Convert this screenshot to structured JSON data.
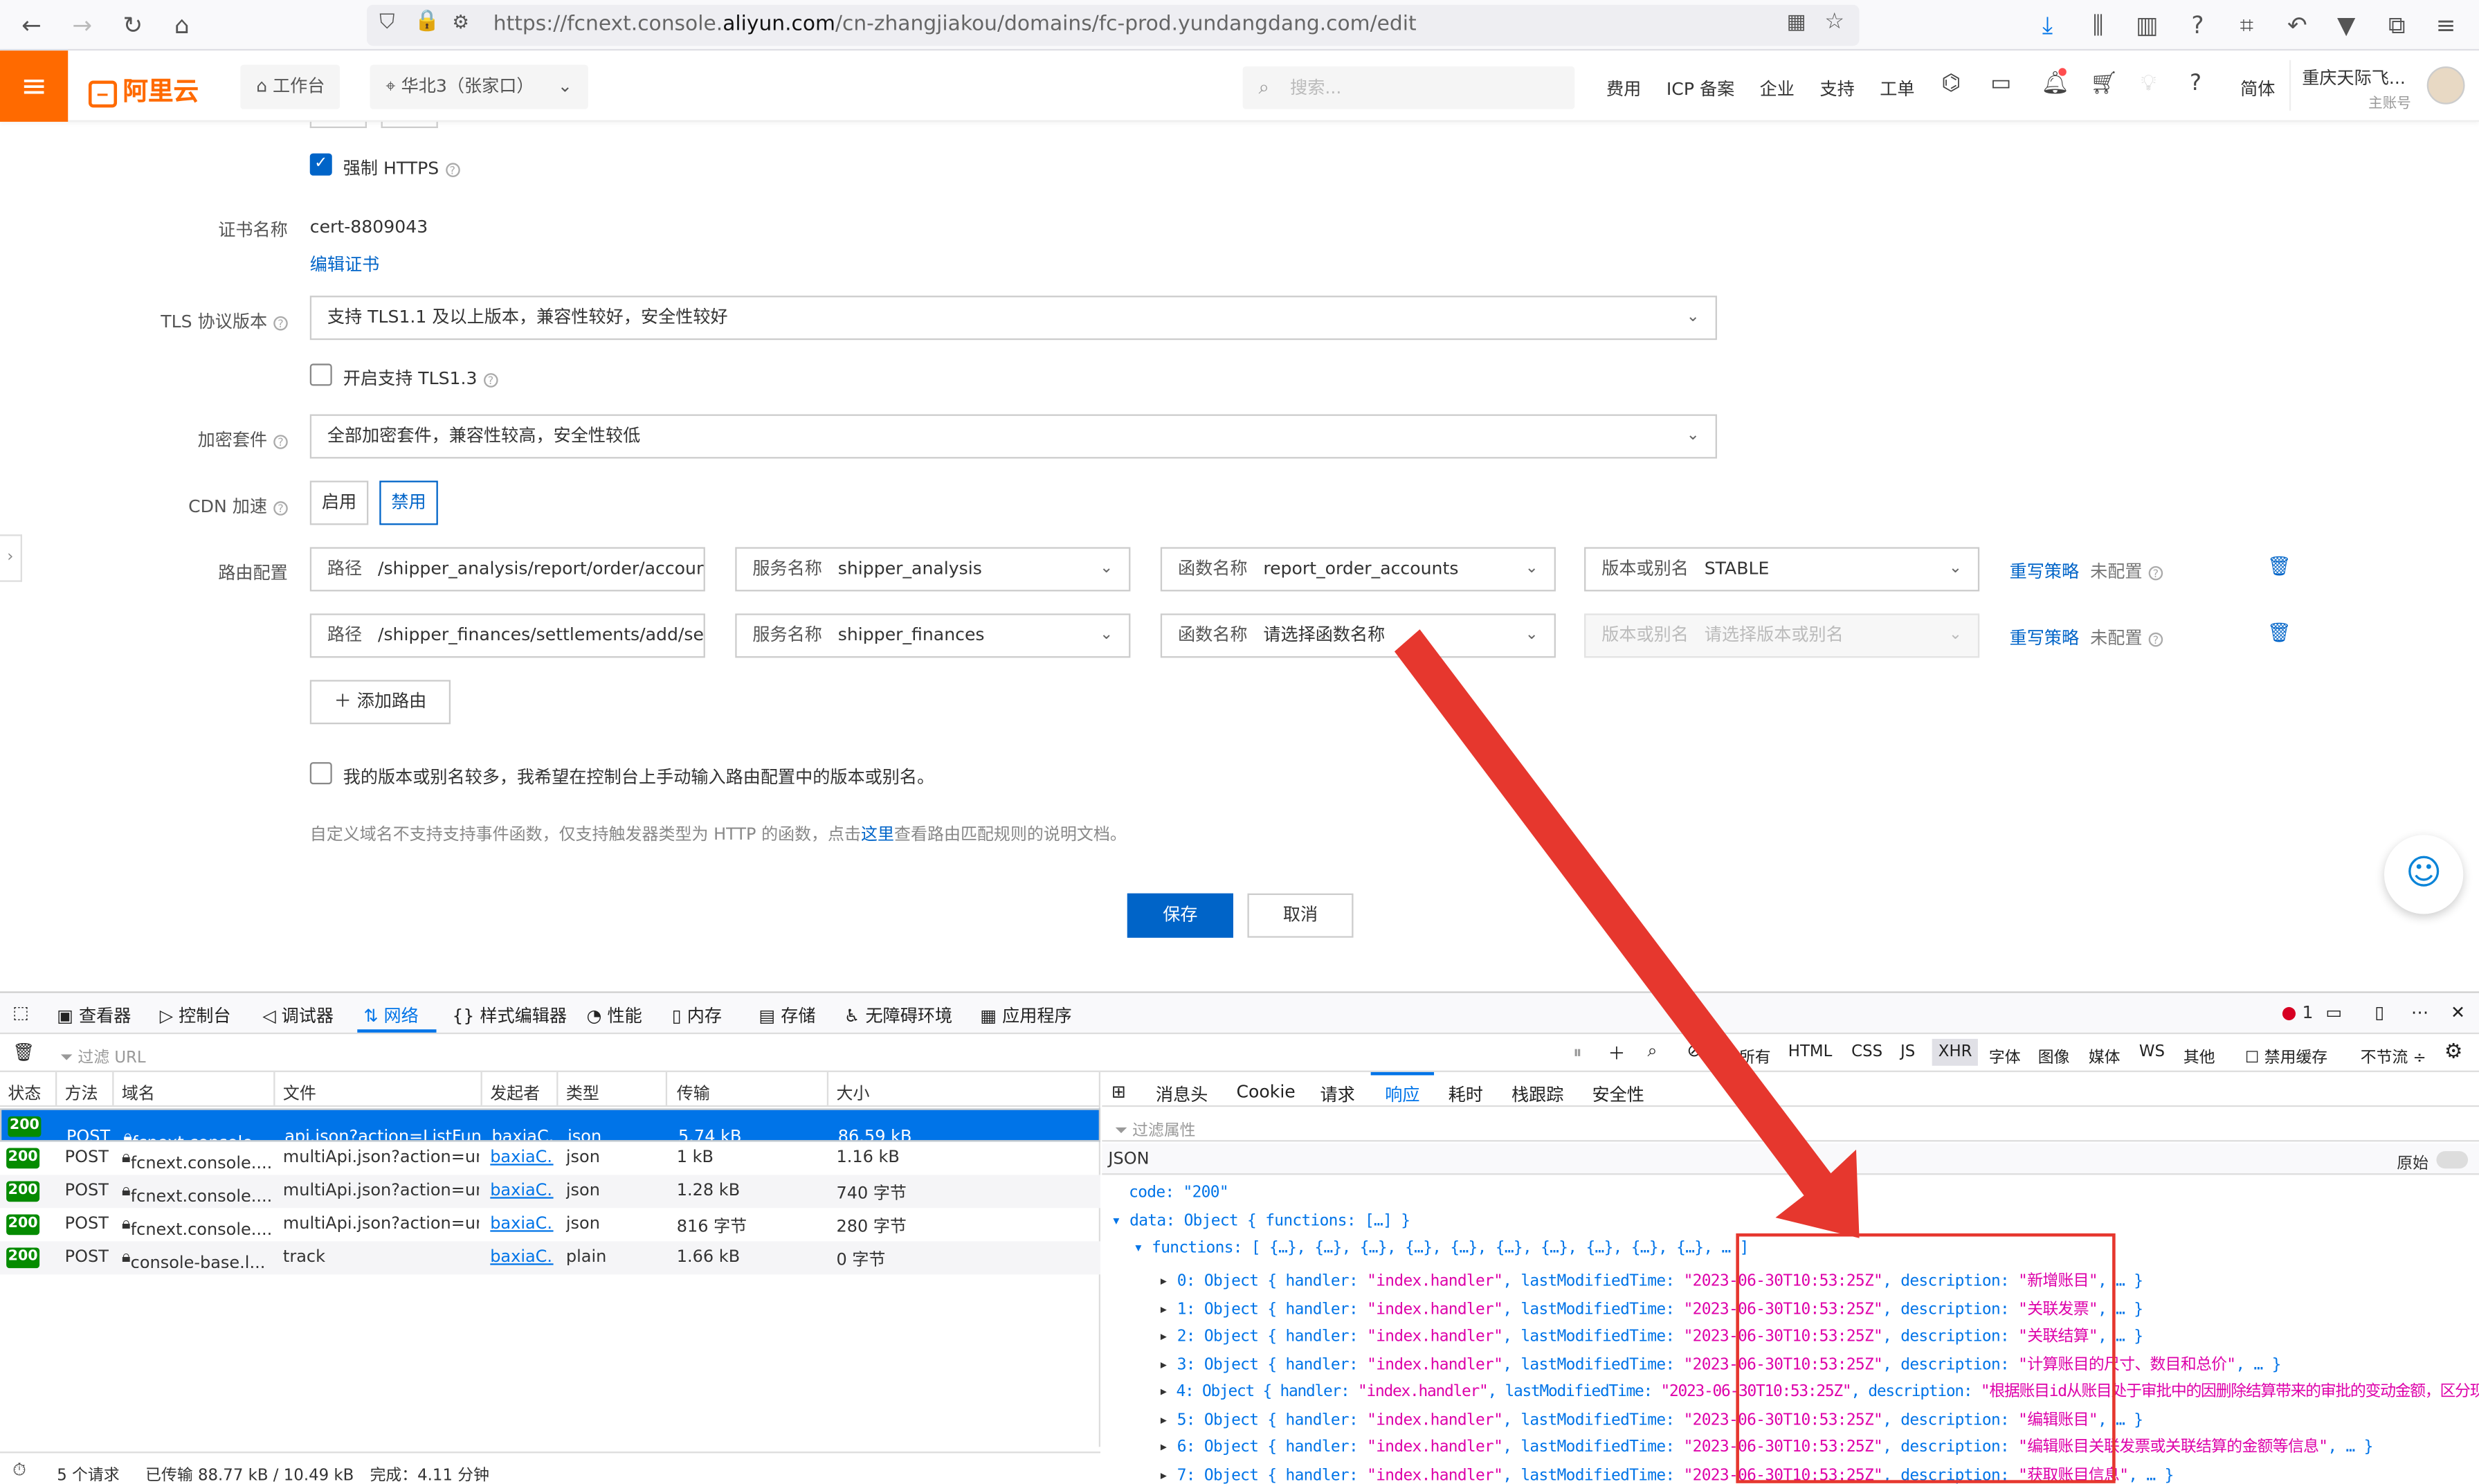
{
  "browser": {
    "url_prefix": "https://fcnext.console.",
    "url_domain": "aliyun.com",
    "url_suffix": "/cn-zhangjiakou/domains/fc-prod.yundangdang.com/edit"
  },
  "header": {
    "logo": "阿里云",
    "workbench": "工作台",
    "region": "华北3（张家口）",
    "search_placeholder": "搜索...",
    "nav": [
      "费用",
      "ICP 备案",
      "企业",
      "支持",
      "工单"
    ],
    "lang": "简体",
    "user_name": "重庆天际飞...",
    "user_role": "主账号"
  },
  "form": {
    "force_https": "强制 HTTPS",
    "cert_label": "证书名称",
    "cert_value": "cert-8809043",
    "edit_cert": "编辑证书",
    "tls_label": "TLS 协议版本",
    "tls_value": "支持 TLS1.1 及以上版本，兼容性较好，安全性较好",
    "tls13": "开启支持 TLS1.3",
    "cipher_label": "加密套件",
    "cipher_value": "全部加密套件，兼容性较高，安全性较低",
    "cdn_label": "CDN 加速",
    "cdn_on": "启用",
    "cdn_off": "禁用",
    "route_label": "路由配置",
    "routes": [
      {
        "path_label": "路径",
        "path": "/shipper_analysis/report/order/accounts",
        "svc_label": "服务名称",
        "svc": "shipper_analysis",
        "fn_label": "函数名称",
        "fn": "report_order_accounts",
        "ver_label": "版本或别名",
        "ver": "STABLE",
        "rewrite": "重写策略",
        "status": "未配置"
      },
      {
        "path_label": "路径",
        "path": "/shipper_finances/settlements/add/settlements",
        "svc_label": "服务名称",
        "svc": "shipper_finances",
        "fn_label": "函数名称",
        "fn": "请选择函数名称",
        "ver_label": "版本或别名",
        "ver": "请选择版本或别名",
        "rewrite": "重写策略",
        "status": "未配置"
      }
    ],
    "add_route": "添加路由",
    "manual_check": "我的版本或别名较多，我希望在控制台上手动输入路由配置中的版本或别名。",
    "note_pre": "自定义域名不支持支持事件函数，仅支持触发器类型为 HTTP 的函数，点击",
    "note_link": "这里",
    "note_post": "查看路由匹配规则的说明文档。",
    "save": "保存",
    "cancel": "取消"
  },
  "devtools": {
    "tabs": [
      "查看器",
      "控制台",
      "调试器",
      "网络",
      "样式编辑器",
      "性能",
      "内存",
      "存储",
      "无障碍环境",
      "应用程序"
    ],
    "error_count": "1",
    "filter_placeholder": "过滤 URL",
    "type_filters": [
      "所有",
      "HTML",
      "CSS",
      "JS",
      "XHR",
      "字体",
      "图像",
      "媒体",
      "WS",
      "其他"
    ],
    "disable_cache": "禁用缓存",
    "throttle": "不节流 ÷",
    "columns": [
      "状态",
      "方法",
      "域名",
      "文件",
      "发起者",
      "类型",
      "传输",
      "大小"
    ],
    "requests": [
      {
        "status": "200",
        "method": "POST",
        "domain": "fcnext.console....",
        "file": "api.json?action=ListFunctio",
        "initiator": "baxiaC...",
        "type": "json",
        "transferred": "5.74 kB",
        "size": "86.59 kB"
      },
      {
        "status": "200",
        "method": "POST",
        "domain": "fcnext.console....",
        "file": "multiApi.json?action=undef",
        "initiator": "baxiaC...",
        "type": "json",
        "transferred": "1 kB",
        "size": "1.16 kB"
      },
      {
        "status": "200",
        "method": "POST",
        "domain": "fcnext.console....",
        "file": "multiApi.json?action=undef",
        "initiator": "baxiaC...",
        "type": "json",
        "transferred": "1.28 kB",
        "size": "740 字节"
      },
      {
        "status": "200",
        "method": "POST",
        "domain": "fcnext.console....",
        "file": "multiApi.json?action=undef",
        "initiator": "baxiaC...",
        "type": "json",
        "transferred": "816 字节",
        "size": "280 字节"
      },
      {
        "status": "200",
        "method": "POST",
        "domain": "console-base.l...",
        "file": "track",
        "initiator": "baxiaC...",
        "type": "plain",
        "transferred": "1.66 kB",
        "size": "0 字节"
      }
    ],
    "status_requests": "5 个请求",
    "status_transferred": "已传输 88.77 kB / 10.49 kB",
    "status_finish": "完成：4.11 分钟",
    "resp_tabs": [
      "消息头",
      "Cookie",
      "请求",
      "响应",
      "耗时",
      "栈跟踪",
      "安全性"
    ],
    "filter_props": "过滤属性",
    "json_label": "JSON",
    "raw_label": "原始",
    "json": {
      "code_line": "code: \"200\"",
      "data_line": "data: Object { functions: […] }",
      "functions_line": "functions: [ {…}, {…}, {…}, {…}, {…}, {…}, {…}, {…}, {…}, {…}, … ]",
      "items": [
        {
          "idx": "0: Object { handler: ",
          "handler": "\"index.handler\"",
          "mid": ", lastModifiedTime: ",
          "time": "\"2023-06-30T10:53:25Z\"",
          "dlabel": ", description: ",
          "desc": "\"新增账目\"",
          "end": ", … }"
        },
        {
          "idx": "1: Object { handler: ",
          "handler": "\"index.handler\"",
          "mid": ", lastModifiedTime: ",
          "time": "\"2023-06-30T10:53:25Z\"",
          "dlabel": ", description: ",
          "desc": "\"关联发票\"",
          "end": ", … }"
        },
        {
          "idx": "2: Object { handler: ",
          "handler": "\"index.handler\"",
          "mid": ", lastModifiedTime: ",
          "time": "\"2023-06-30T10:53:25Z\"",
          "dlabel": ", description: ",
          "desc": "\"关联结算\"",
          "end": ", … }"
        },
        {
          "idx": "3: Object { handler: ",
          "handler": "\"index.handler\"",
          "mid": ", lastModifiedTime: ",
          "time": "\"2023-06-30T10:53:25Z\"",
          "dlabel": ", description: ",
          "desc": "\"计算账目的尺寸、数目和总价\"",
          "end": ", … }"
        },
        {
          "idx": "4: Object { handler: ",
          "handler": "\"index.handler\"",
          "mid": ", lastModifiedTime: ",
          "time": "\"2023-06-30T10:53:25Z\"",
          "dlabel": ", description: ",
          "desc": "\"根据账目id从账目处于审批中的因删除结算带来的审批的变动金额，区分现金和油卡\"",
          "end": ", … }"
        },
        {
          "idx": "5: Object { handler: ",
          "handler": "\"index.handler\"",
          "mid": ", lastModifiedTime: ",
          "time": "\"2023-06-30T10:53:25Z\"",
          "dlabel": ", description: ",
          "desc": "\"编辑账目\"",
          "end": ", … }"
        },
        {
          "idx": "6: Object { handler: ",
          "handler": "\"index.handler\"",
          "mid": ", lastModifiedTime: ",
          "time": "\"2023-06-30T10:53:25Z\"",
          "dlabel": ", description: ",
          "desc": "\"编辑账目关联发票或关联结算的金额等信息\"",
          "end": ", … }"
        },
        {
          "idx": "7: Object { handler: ",
          "handler": "\"index.handler\"",
          "mid": ", lastModifiedTime: ",
          "time": "\"2023-06-30T10:53:25Z\"",
          "dlabel": ", description: ",
          "desc": "\"获取账目信息\"",
          "end": ", … }"
        }
      ]
    }
  },
  "colors": {
    "brand": "#ff6a00",
    "primary": "#0064c8",
    "annotation": "#e6372e",
    "status_ok": "#058b00",
    "devtools_accent": "#0074e8"
  }
}
